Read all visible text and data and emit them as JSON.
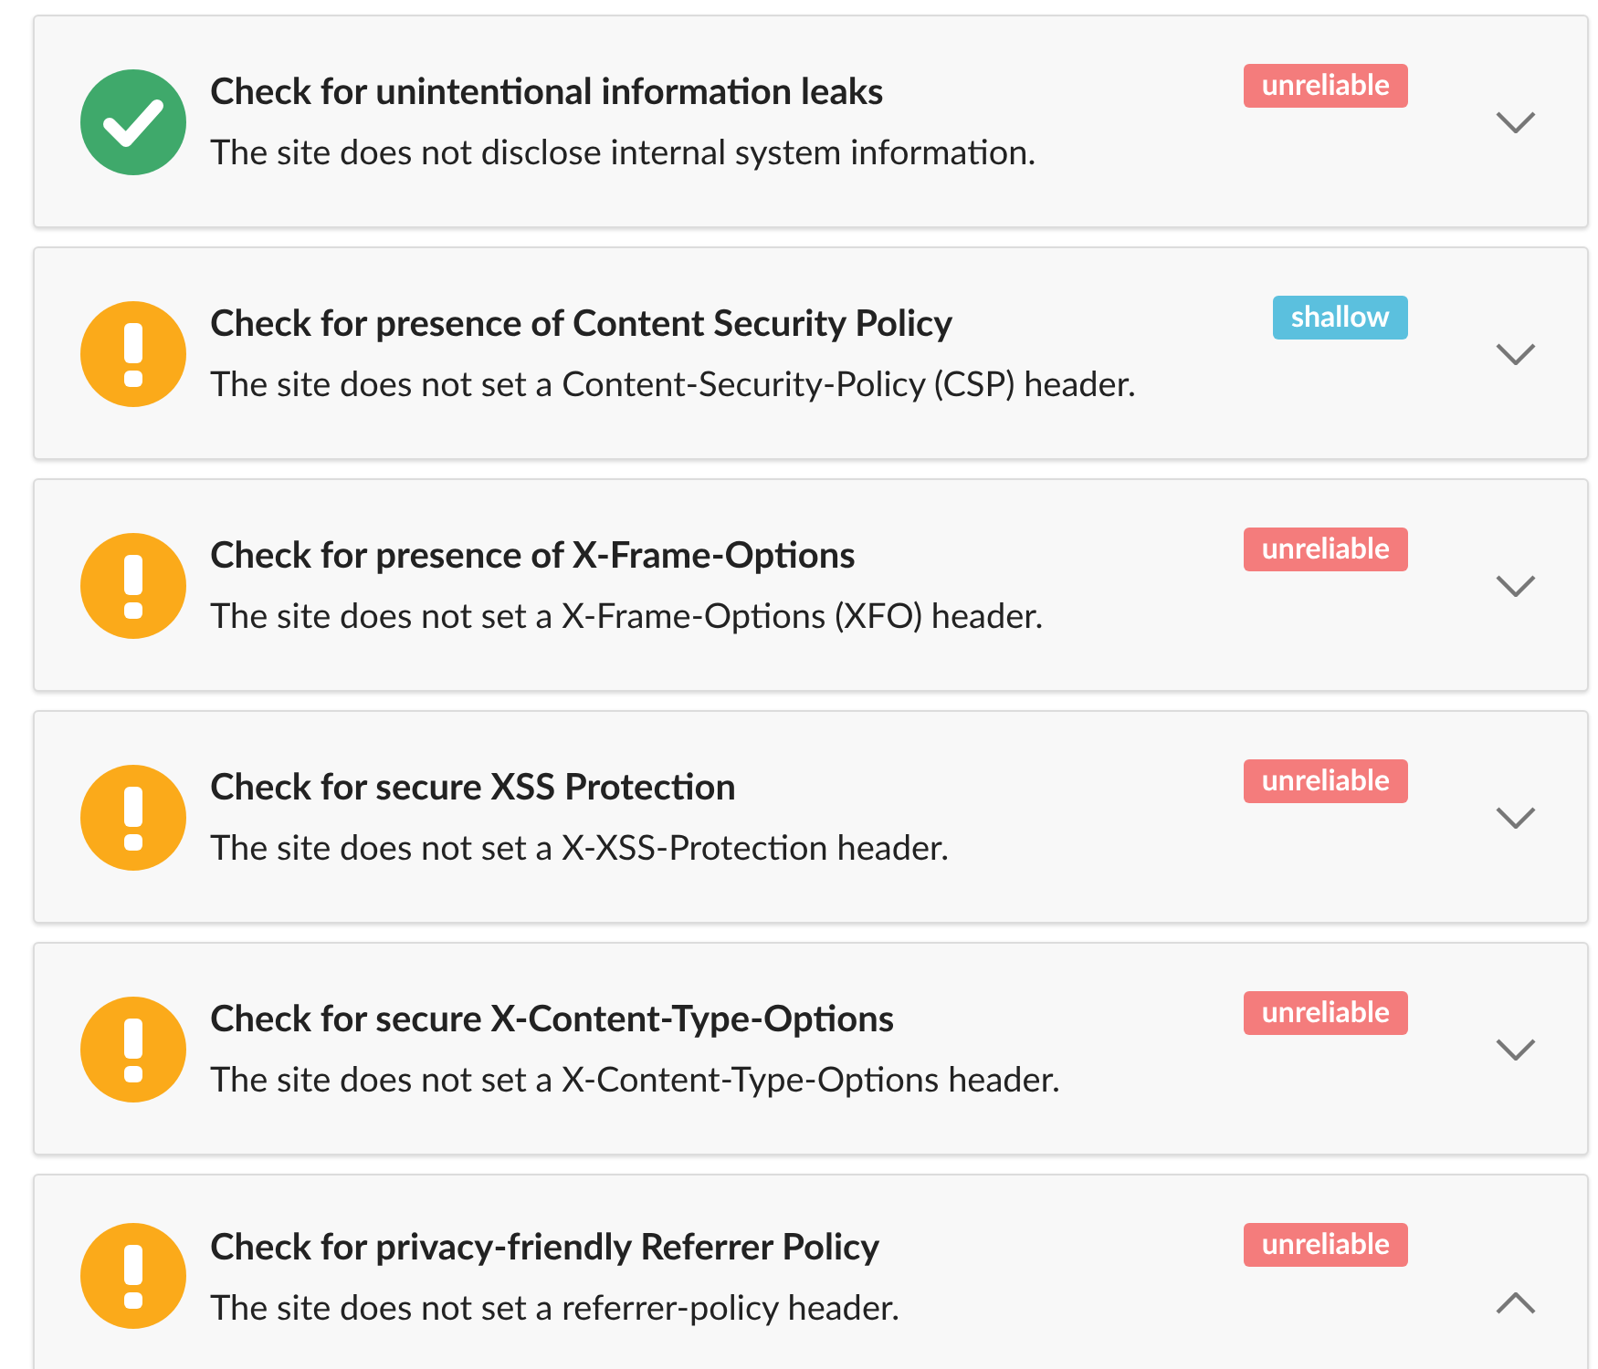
{
  "checks": [
    {
      "kind": "pass",
      "title": "Check for unintentional information leaks",
      "description": "The site does not disclose internal system information.",
      "badge": {
        "kind": "unreliable",
        "label": "unreliable"
      },
      "expanded": false
    },
    {
      "kind": "warning",
      "title": "Check for presence of Content Security Policy",
      "description": "The site does not set a Content-Security-Policy (CSP) header.",
      "badge": {
        "kind": "shallow",
        "label": "shallow"
      },
      "expanded": false
    },
    {
      "kind": "warning",
      "title": "Check for presence of X-Frame-Options",
      "description": "The site does not set a X-Frame-Options (XFO) header.",
      "badge": {
        "kind": "unreliable",
        "label": "unreliable"
      },
      "expanded": false
    },
    {
      "kind": "warning",
      "title": "Check for secure XSS Protection",
      "description": "The site does not set a X-XSS-Protection header.",
      "badge": {
        "kind": "unreliable",
        "label": "unreliable"
      },
      "expanded": false
    },
    {
      "kind": "warning",
      "title": "Check for secure X-Content-Type-Options",
      "description": "The site does not set a X-Content-Type-Options header.",
      "badge": {
        "kind": "unreliable",
        "label": "unreliable"
      },
      "expanded": false
    },
    {
      "kind": "warning",
      "title": "Check for privacy-friendly Referrer Policy",
      "description": "The site does not set a referrer-policy header.",
      "badge": {
        "kind": "unreliable",
        "label": "unreliable"
      },
      "expanded": true
    }
  ]
}
